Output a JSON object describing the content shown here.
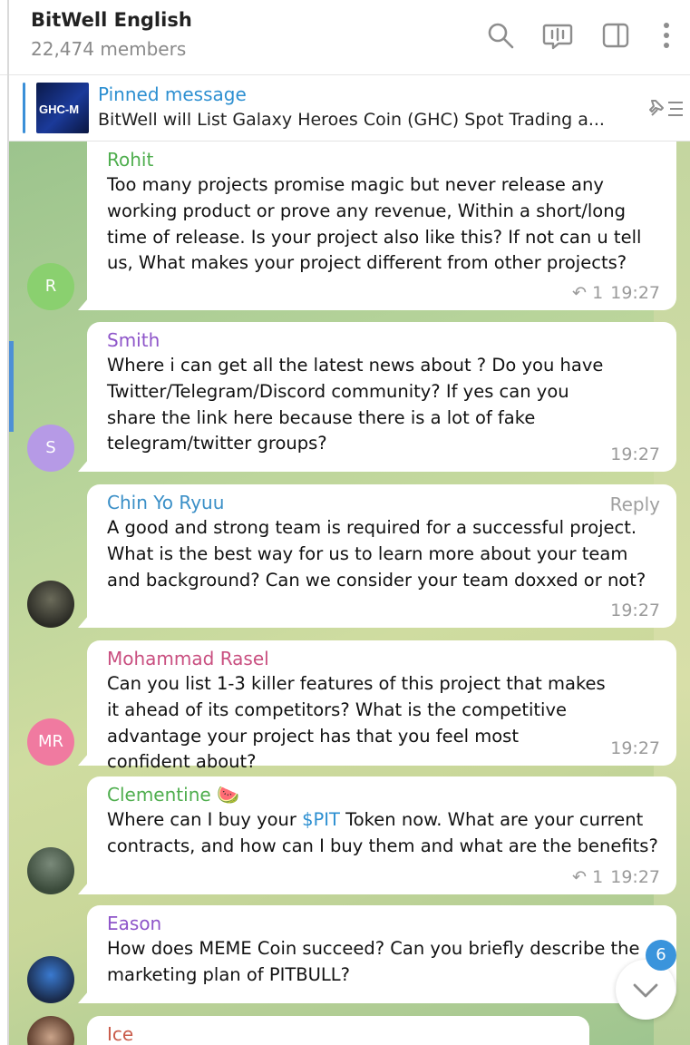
{
  "header": {
    "title": "BitWell English",
    "members": "22,474 members",
    "icons": [
      "search-icon",
      "live-chat-icon",
      "sidebar-toggle-icon",
      "more-icon"
    ]
  },
  "pinned": {
    "label": "Pinned message",
    "thumb_text": "GHC-M",
    "text": "BitWell will List Galaxy Heroes Coin (GHC) Spot Trading a..."
  },
  "messages": [
    {
      "author": "Rohit",
      "author_color": "#4fae4e",
      "avatar_letter": "R",
      "avatar_color": "#8ad06f",
      "text": "Too many projects promise magic but never release any working product or prove any revenue, Within a short/long time of release. Is your project also like this? If not can u tell us, What makes your project different from other projects?",
      "replies": "1",
      "time": "19:27"
    },
    {
      "author": "Smith",
      "author_color": "#8e55c9",
      "avatar_letter": "S",
      "avatar_color": "#b69ae6",
      "text": "Where i can get all the latest news about ? Do you have Twitter/Telegram/Discord community? If yes can you share the link here because there is a lot of fake telegram/twitter groups?",
      "time": "19:27"
    },
    {
      "author": "Chin Yo Ryuu",
      "author_color": "#3a8fc7",
      "reply_label": "Reply",
      "text": "A good and strong team is required for a successful project. What is the best way for us to learn more about your team and background? Can we consider your team doxxed or not?",
      "time": "19:27"
    },
    {
      "author": "Mohammad Rasel",
      "author_color": "#c94f80",
      "avatar_letter": "MR",
      "avatar_color": "#f07aa0",
      "text": "Can you list 1-3 killer features of this project that makes it ahead of its competitors? What is the competitive advantage your project has that you feel most confident about?",
      "time": "19:27"
    },
    {
      "author": "Clementine 🍉",
      "author_color": "#4fae4e",
      "text_before": "Where can I buy your ",
      "cashtag": "$PIT",
      "text_after": " Token now. What are your current contracts, and how can I buy them and what are the benefits?",
      "replies": "1",
      "time": "19:27"
    },
    {
      "author": "Eason",
      "author_color": "#8e55c9",
      "text": "How does MEME Coin succeed? Can you briefly describe the marketing plan of PITBULL?"
    },
    {
      "author": "Ice"
    }
  ],
  "unread_badge": "6"
}
